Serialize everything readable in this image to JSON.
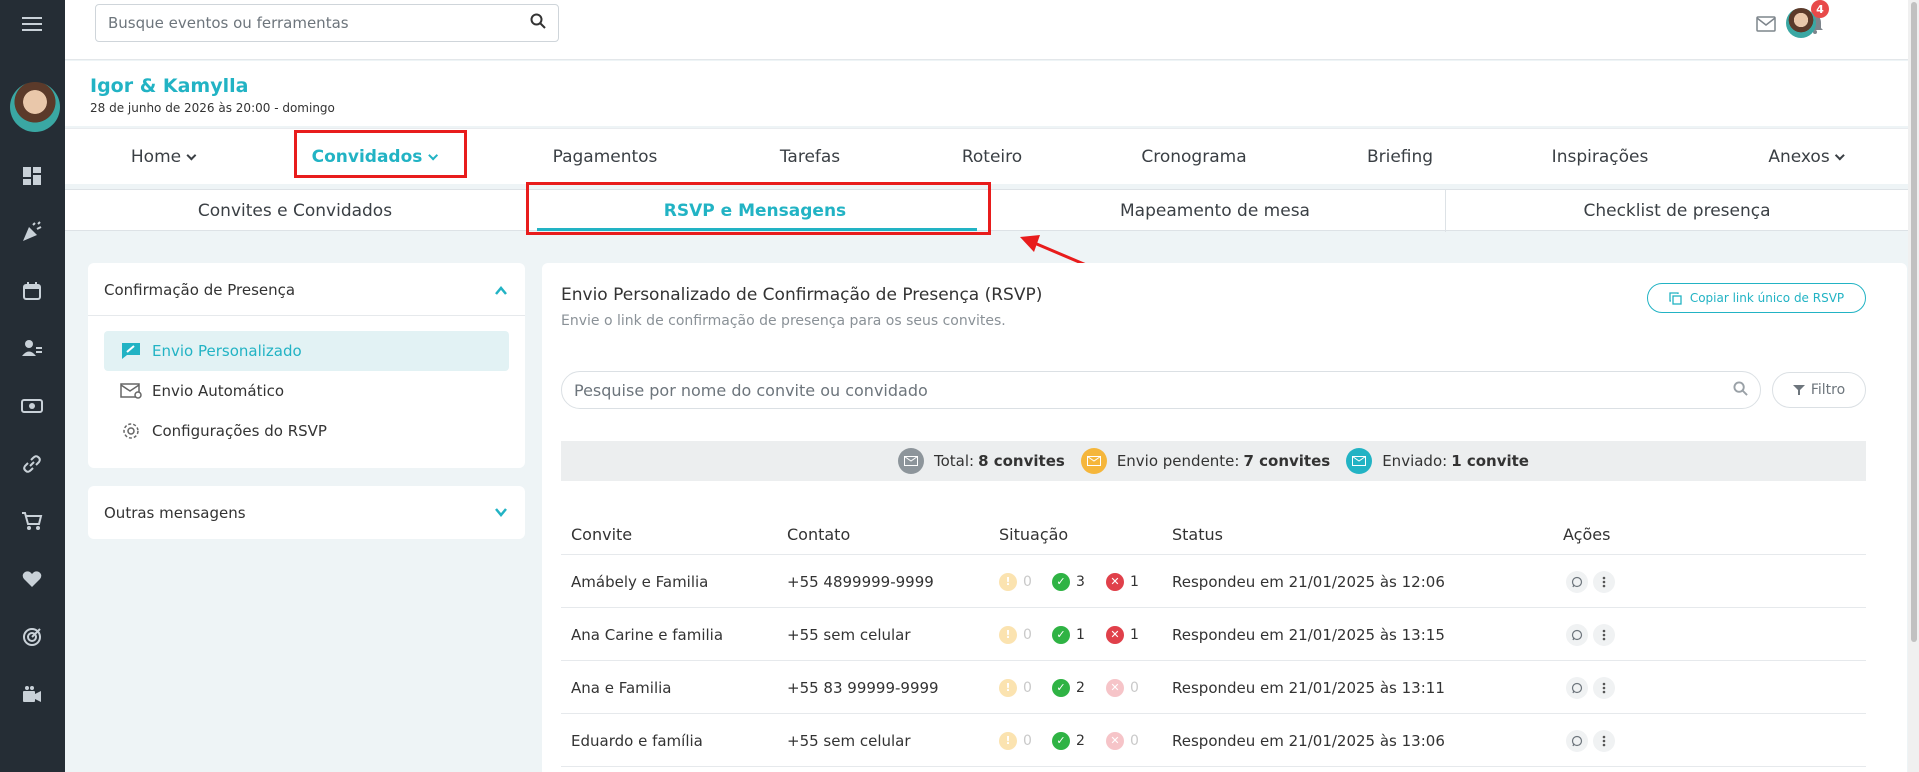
{
  "topbar": {
    "search_placeholder": "Busque eventos ou ferramentas",
    "notification_count": "4"
  },
  "event": {
    "name": "Igor & Kamylla",
    "date": "28 de junho de 2026 às 20:00 - domingo"
  },
  "main_nav": [
    {
      "label": "Home",
      "dropdown": true
    },
    {
      "label": "Convidados",
      "dropdown": true,
      "active": true
    },
    {
      "label": "Pagamentos"
    },
    {
      "label": "Tarefas"
    },
    {
      "label": "Roteiro"
    },
    {
      "label": "Cronograma"
    },
    {
      "label": "Briefing"
    },
    {
      "label": "Inspirações"
    },
    {
      "label": "Anexos",
      "dropdown": true
    }
  ],
  "sub_nav": [
    {
      "label": "Convites e Convidados"
    },
    {
      "label": "RSVP e Mensagens",
      "active": true
    },
    {
      "label": "Mapeamento de mesa"
    },
    {
      "label": "Checklist de presença"
    }
  ],
  "left_panel": {
    "section_title": "Confirmação de Presença",
    "items": [
      {
        "label": "Envio Personalizado",
        "icon": "send-personal-icon",
        "active": true
      },
      {
        "label": "Envio Automático",
        "icon": "auto-mail-icon"
      },
      {
        "label": "Configurações do RSVP",
        "icon": "gear-icon"
      }
    ],
    "other_title": "Outras mensagens"
  },
  "content": {
    "title": "Envio Personalizado de Confirmação de Presença (RSVP)",
    "subtitle": "Envie o link de confirmação de presença para os seus convites.",
    "copy_button": "Copiar link único de RSVP",
    "search_placeholder": "Pesquise por nome do convite ou convidado",
    "filter_label": "Filtro",
    "summary": {
      "total_label": "Total:",
      "total_value": "8 convites",
      "pending_label": "Envio pendente:",
      "pending_value": "7 convites",
      "sent_label": "Enviado:",
      "sent_value": "1 convite"
    },
    "columns": [
      "Convite",
      "Contato",
      "Situação",
      "Status",
      "Ações"
    ],
    "rows": [
      {
        "invite": "Amábely e Familia",
        "contact": "+55 4899999-9999",
        "pending": "0",
        "yes": "3",
        "no": "1",
        "status": "Respondeu em 21/01/2025 às 12:06"
      },
      {
        "invite": "Ana Carine e familia",
        "contact": "+55 sem celular",
        "pending": "0",
        "yes": "1",
        "no": "1",
        "status": "Respondeu em 21/01/2025 às 13:15"
      },
      {
        "invite": "Ana e Familia",
        "contact": "+55 83 99999-9999",
        "pending": "0",
        "yes": "2",
        "no": "0",
        "status": "Respondeu em 21/01/2025 às 13:11"
      },
      {
        "invite": "Eduardo e família",
        "contact": "+55 sem celular",
        "pending": "0",
        "yes": "2",
        "no": "0",
        "status": "Respondeu em 21/01/2025 às 13:06"
      }
    ]
  },
  "colors": {
    "accent": "#22b3c4",
    "sidebar": "#252d35",
    "annotation_red": "#e81c1c",
    "success": "#2fb344",
    "danger": "#e0404a",
    "warning": "#f5b63b"
  }
}
